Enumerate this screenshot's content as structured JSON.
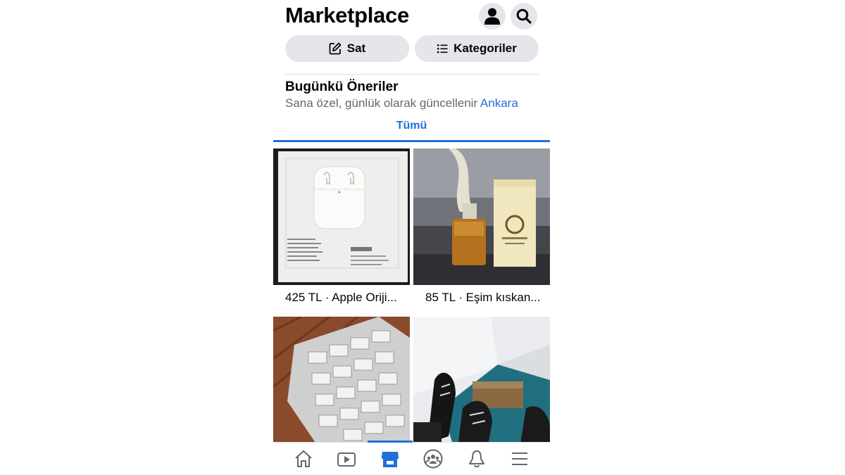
{
  "header": {
    "title": "Marketplace",
    "profile_icon": "person-icon",
    "search_icon": "search-icon"
  },
  "actions": {
    "sell": {
      "label": "Sat",
      "icon": "compose-icon"
    },
    "categories": {
      "label": "Kategoriler",
      "icon": "list-icon"
    }
  },
  "section": {
    "title": "Bugünkü Öneriler",
    "subtitle": "Sana özel, günlük olarak güncellenir",
    "location": "Ankara"
  },
  "tabs": {
    "all": "Tümü"
  },
  "listings": [
    {
      "caption": "425 TL · Apple Oriji..."
    },
    {
      "caption": "85 TL · Eşim kıskan..."
    },
    {
      "caption": ""
    },
    {
      "caption": ""
    }
  ],
  "nav": [
    "home-icon",
    "video-icon",
    "marketplace-icon",
    "groups-icon",
    "notifications-icon",
    "menu-icon"
  ],
  "colors": {
    "accent": "#216fdb",
    "pill_bg": "#e4e6eb",
    "text": "#050505",
    "secondary": "#65676b"
  }
}
